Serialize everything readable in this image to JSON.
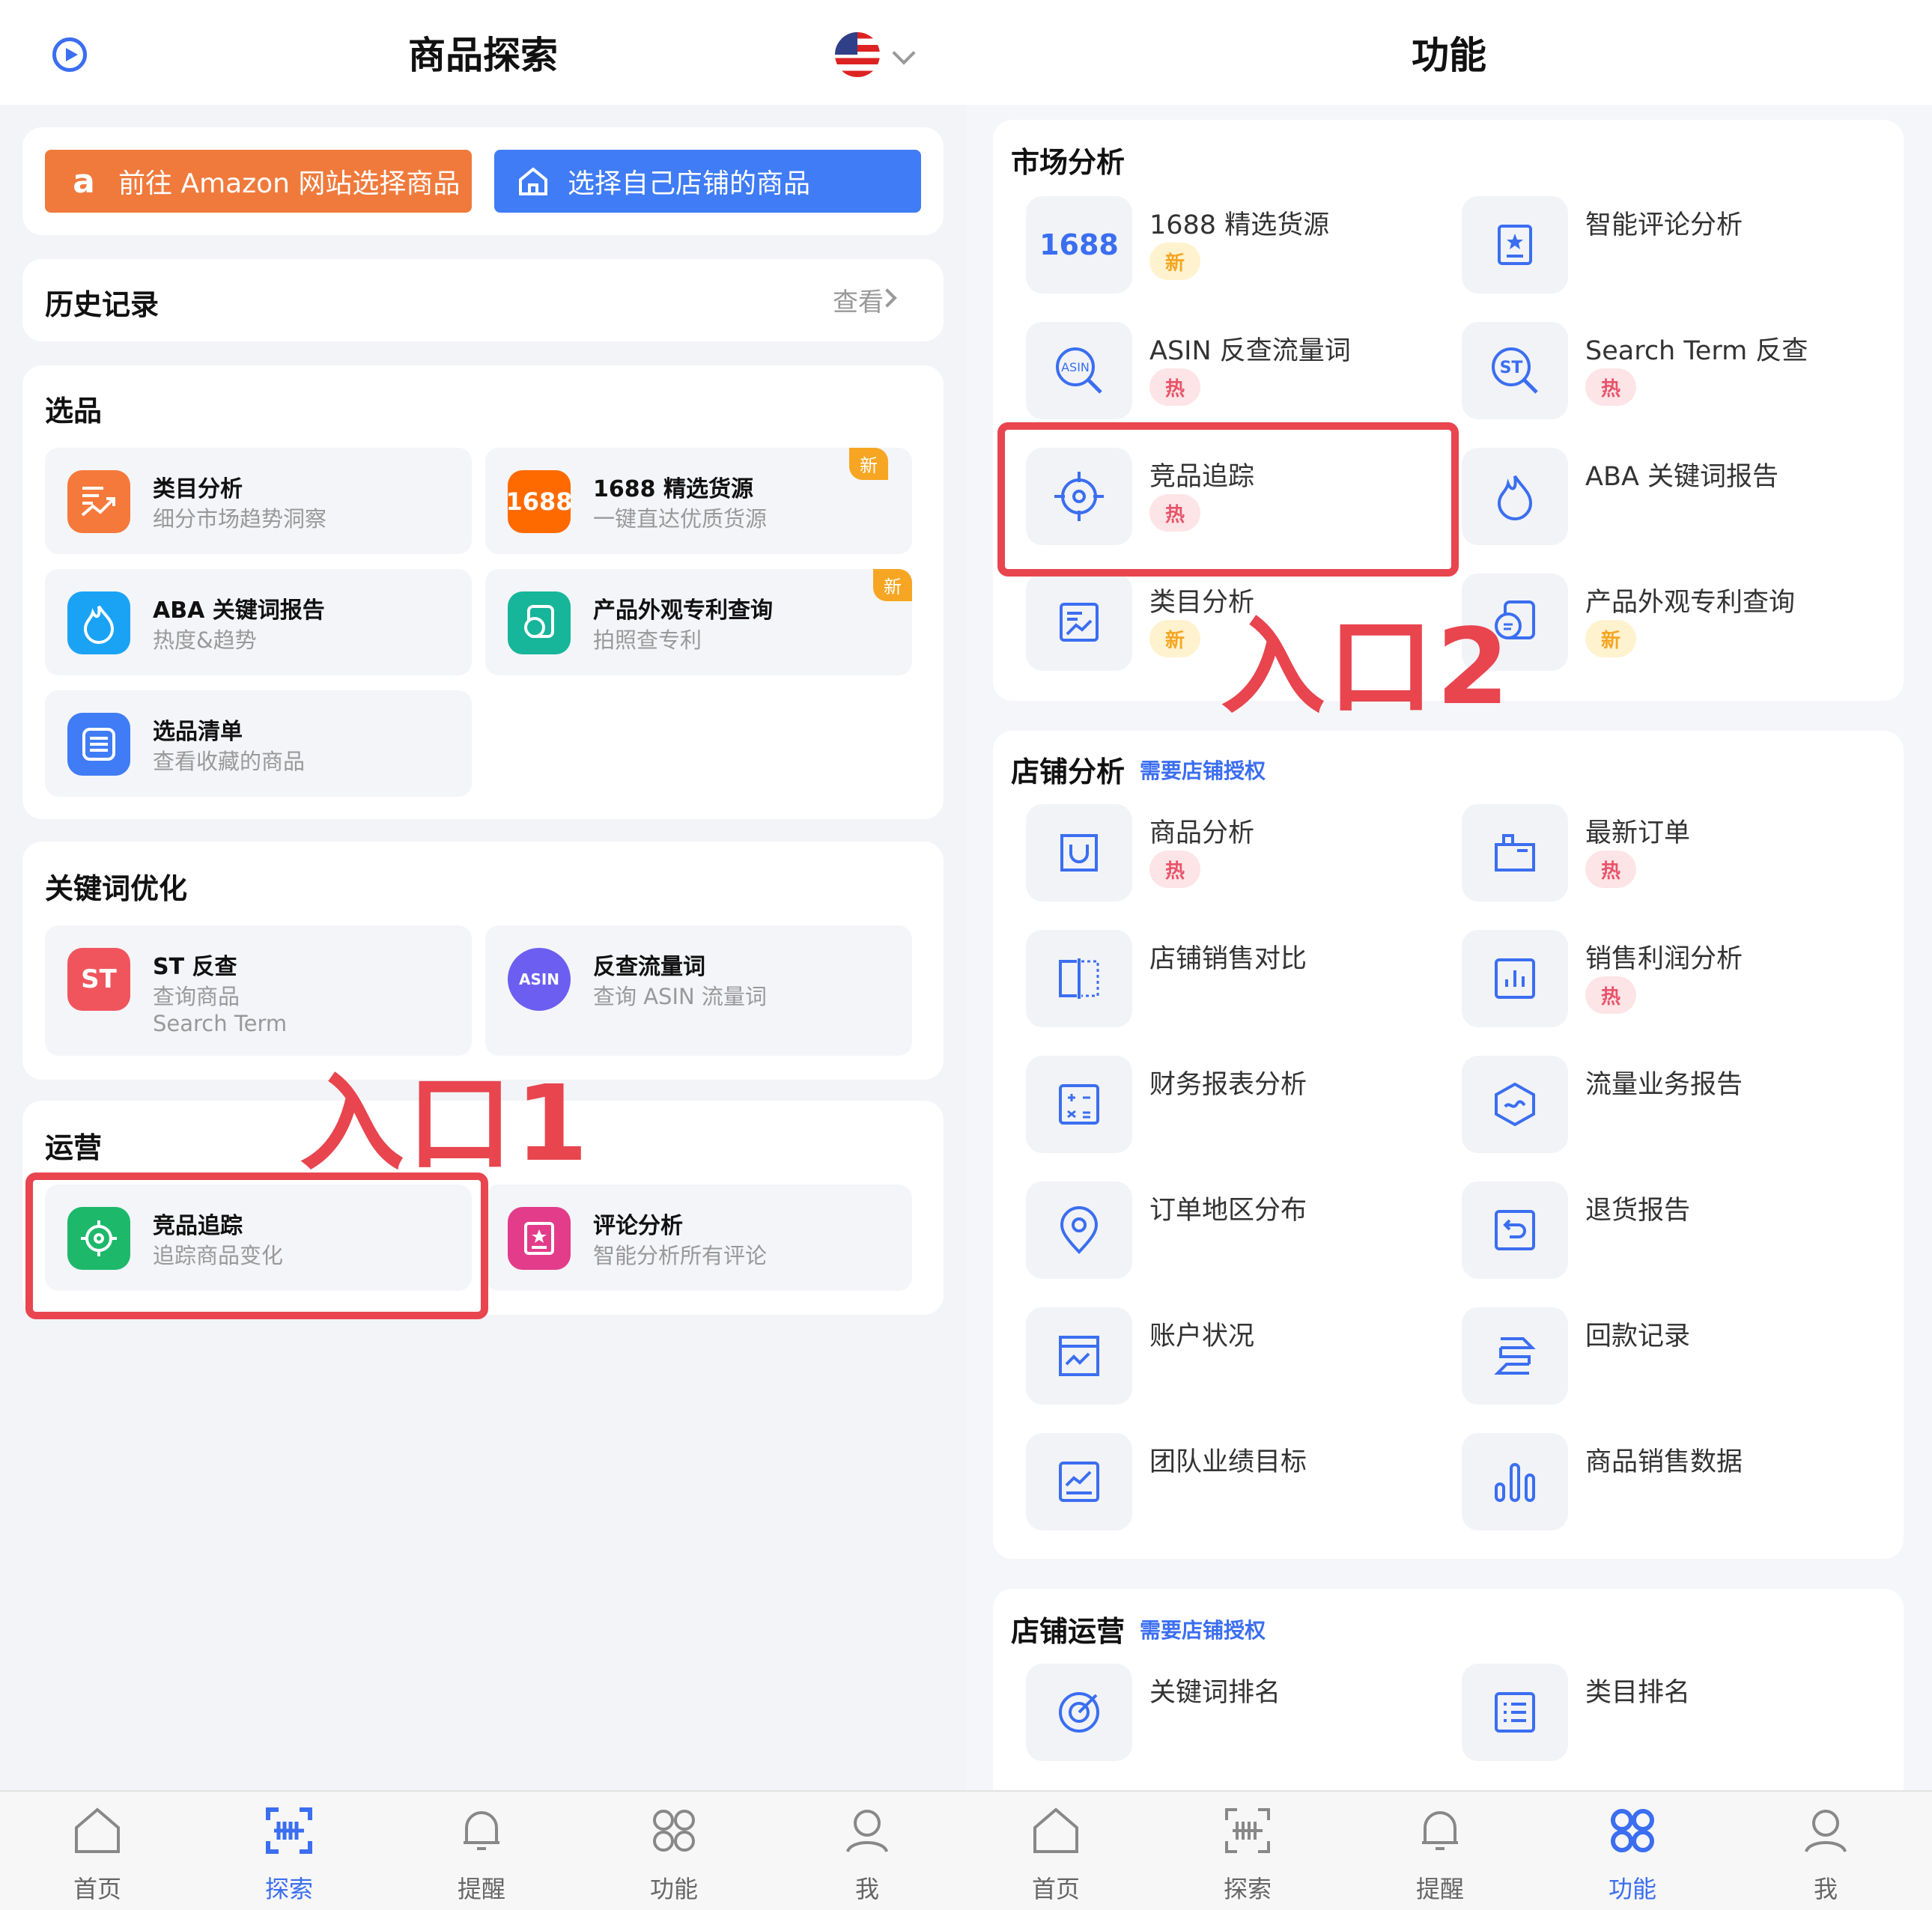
{
  "left": {
    "title": "商品探索",
    "amazon_button": "前往 Amazon 网站选择商品",
    "store_button": "选择自己店铺的商品",
    "history": {
      "title": "历史记录",
      "more": "查看"
    },
    "selection": {
      "title": "选品",
      "tiles": [
        {
          "title": "类目分析",
          "sub": "细分市场趋势洞察",
          "icon": "trend-icon",
          "color": "#f5793b"
        },
        {
          "title": "1688 精选货源",
          "sub": "一键直达优质货源",
          "icon": "1688-logo-icon",
          "icon_text": "1688",
          "badge": "新",
          "color": "#ff6a00"
        },
        {
          "title": "ABA 关键词报告",
          "sub": "热度&趋势",
          "icon": "flame-icon",
          "color": "#1aa3f5"
        },
        {
          "title": "产品外观专利查询",
          "sub": "拍照查专利",
          "icon": "patent-search-icon",
          "badge": "新",
          "color": "#17b59a"
        },
        {
          "title": "选品清单",
          "sub": "查看收藏的商品",
          "icon": "list-icon",
          "color": "#3f7cf5"
        }
      ]
    },
    "keyword": {
      "title": "关键词优化",
      "tiles": [
        {
          "title": "ST 反查",
          "sub": "查询商品",
          "sub2": "Search Term",
          "icon": "st-icon",
          "icon_text": "ST",
          "color": "#f0555e"
        },
        {
          "title": "反查流量词",
          "sub": "查询 ASIN 流量词",
          "icon": "asin-icon",
          "icon_text": "ASIN",
          "color": "#6b5ef0"
        }
      ]
    },
    "ops": {
      "title": "运营",
      "tiles": [
        {
          "title": "竞品追踪",
          "sub": "追踪商品变化",
          "icon": "target-icon",
          "color": "#1eb86b"
        },
        {
          "title": "评论分析",
          "sub": "智能分析所有评论",
          "icon": "review-icon",
          "color": "#e23c8a"
        }
      ]
    },
    "annotation": "入口1"
  },
  "right": {
    "title": "功能",
    "annotation": "入口2",
    "market": {
      "title": "市场分析",
      "items": [
        {
          "label": "1688 精选货源",
          "badge": "新",
          "icon": "1688-logo-icon",
          "icon_text": "1688"
        },
        {
          "label": "智能评论分析",
          "icon": "review-icon"
        },
        {
          "label": "ASIN 反查流量词",
          "badge": "热",
          "icon": "asin-search-icon",
          "icon_text": "ASIN"
        },
        {
          "label": "Search Term 反查",
          "badge": "热",
          "icon": "st-search-icon",
          "icon_text": "ST"
        },
        {
          "label": "竞品追踪",
          "badge": "热",
          "icon": "target-icon"
        },
        {
          "label": "ABA 关键词报告",
          "icon": "flame-icon"
        },
        {
          "label": "类目分析",
          "badge": "新",
          "icon": "trend-icon"
        },
        {
          "label": "产品外观专利查询",
          "badge": "新",
          "icon": "patent-search-icon"
        }
      ]
    },
    "store_analysis": {
      "title": "店铺分析",
      "auth": "需要店铺授权",
      "items": [
        {
          "label": "商品分析",
          "badge": "热",
          "icon": "bag-icon"
        },
        {
          "label": "最新订单",
          "badge": "热",
          "icon": "order-bag-icon"
        },
        {
          "label": "店铺销售对比",
          "icon": "compare-icon"
        },
        {
          "label": "销售利润分析",
          "badge": "热",
          "icon": "bar-chart-icon"
        },
        {
          "label": "财务报表分析",
          "icon": "calculator-icon"
        },
        {
          "label": "流量业务报告",
          "icon": "traffic-icon"
        },
        {
          "label": "订单地区分布",
          "icon": "location-icon"
        },
        {
          "label": "退货报告",
          "icon": "return-icon"
        },
        {
          "label": "账户状况",
          "icon": "account-icon"
        },
        {
          "label": "回款记录",
          "icon": "payment-icon"
        },
        {
          "label": "团队业绩目标",
          "icon": "growth-chart-icon"
        },
        {
          "label": "商品销售数据",
          "icon": "sales-bars-icon"
        }
      ]
    },
    "store_ops": {
      "title": "店铺运营",
      "auth": "需要店铺授权",
      "items": [
        {
          "label": "关键词排名",
          "icon": "keyword-rank-icon"
        },
        {
          "label": "类目排名",
          "icon": "category-rank-icon"
        }
      ]
    }
  },
  "nav": [
    {
      "label": "首页",
      "icon": "home-icon"
    },
    {
      "label": "探索",
      "icon": "scan-icon"
    },
    {
      "label": "提醒",
      "icon": "bell-icon"
    },
    {
      "label": "功能",
      "icon": "grid-icon"
    },
    {
      "label": "我",
      "icon": "user-icon"
    }
  ],
  "nav_active_left": "探索",
  "nav_active_right": "功能",
  "colors": {
    "accent": "#3b6ef0",
    "annotation": "#e8454f",
    "amazon": "#f07a3c"
  }
}
